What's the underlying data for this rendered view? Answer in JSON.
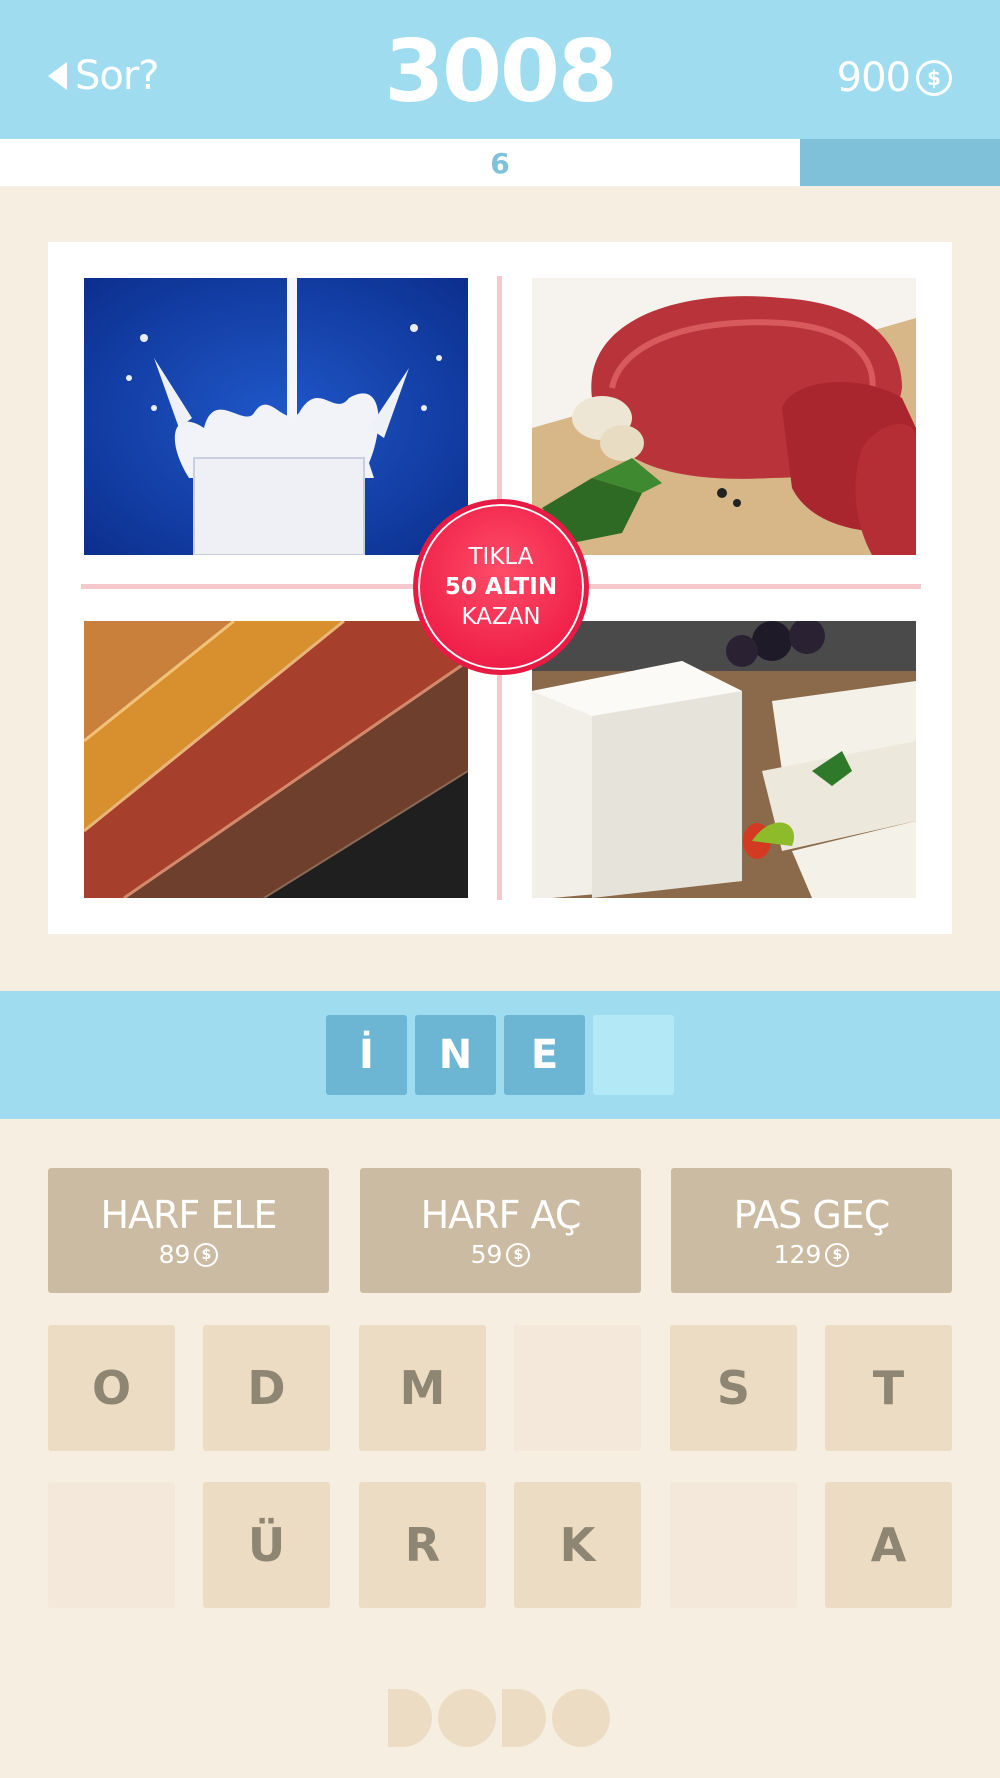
{
  "header": {
    "back_label": "Sor?",
    "level_number": "3008",
    "coins": "900",
    "coin_symbol": "$"
  },
  "progress": {
    "count": "6",
    "fraction_complete": 0.2
  },
  "pictures": [
    {
      "icon": "milk-glass-image"
    },
    {
      "icon": "raw-meat-image"
    },
    {
      "icon": "leather-image"
    },
    {
      "icon": "white-cheese-image"
    }
  ],
  "bonus": {
    "line1": "TIKLA",
    "line2": "50 ALTIN",
    "line3": "KAZAN"
  },
  "answer": {
    "slots": [
      "İ",
      "N",
      "E",
      ""
    ]
  },
  "hints": [
    {
      "label": "HARF ELE",
      "cost": "89",
      "coin_symbol": "$"
    },
    {
      "label": "HARF AÇ",
      "cost": "59",
      "coin_symbol": "$"
    },
    {
      "label": "PAS GEÇ",
      "cost": "129",
      "coin_symbol": "$"
    }
  ],
  "keys": {
    "row1": [
      "O",
      "D",
      "M",
      "",
      "S",
      "T"
    ],
    "row2": [
      "",
      "Ü",
      "R",
      "K",
      "",
      "A"
    ]
  },
  "colors": {
    "header_bg": "#9fdcef",
    "background": "#f7eee2",
    "answer_slot": "#6cb6d3",
    "hint_button": "#cbbba2",
    "key": "#ecdcc3",
    "bonus_red": "#f0214a"
  }
}
